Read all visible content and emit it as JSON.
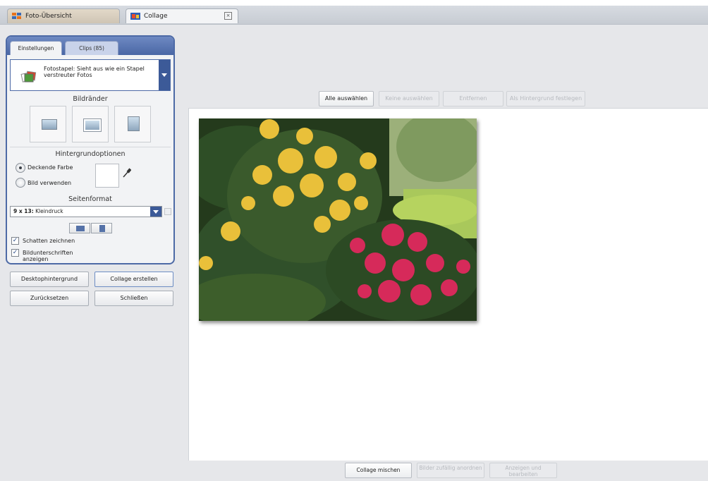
{
  "tabs": [
    {
      "label": "Foto-Übersicht",
      "icon": "grid-icon"
    },
    {
      "label": "Collage",
      "icon": "collage-icon",
      "close_icon": "close-icon"
    }
  ],
  "panel": {
    "tabs": [
      "Einstellungen",
      "Clips (85)"
    ],
    "style_dropdown": {
      "label": "Fotostapel: Sieht aus wie ein Stapel verstreuter Fotos",
      "icon": "photo-stack-icon"
    },
    "borders_title": "Bildränder",
    "background_title": "Hintergrundoptionen",
    "background_options": [
      {
        "label": "Deckende Farbe",
        "selected": true
      },
      {
        "label": "Bild verwenden",
        "selected": false
      }
    ],
    "page_format_title": "Seitenformat",
    "page_format": {
      "bold": "9 x 13:",
      "rest": " Kleindruck"
    },
    "checkboxes": [
      {
        "label": "Schatten zeichnen",
        "checked": true
      },
      {
        "label": "Bildunterschriften anzeigen",
        "checked": true
      }
    ]
  },
  "buttons": {
    "desktop": "Desktophintergrund",
    "create": "Collage erstellen",
    "reset": "Zurücksetzen",
    "close": "Schließen"
  },
  "toolbar": {
    "select_all": "Alle auswählen",
    "select_none": "Keine auswählen",
    "remove": "Entfernen",
    "set_background": "Als Hintergrund festlegen"
  },
  "bottom": {
    "shuffle": "Collage mischen",
    "random": "Bilder zufällig anordnen",
    "view_edit": "Anzeigen und bearbeiten"
  },
  "colors": {
    "accent": "#4d6aa6",
    "dropdown": "#3c5a98"
  }
}
